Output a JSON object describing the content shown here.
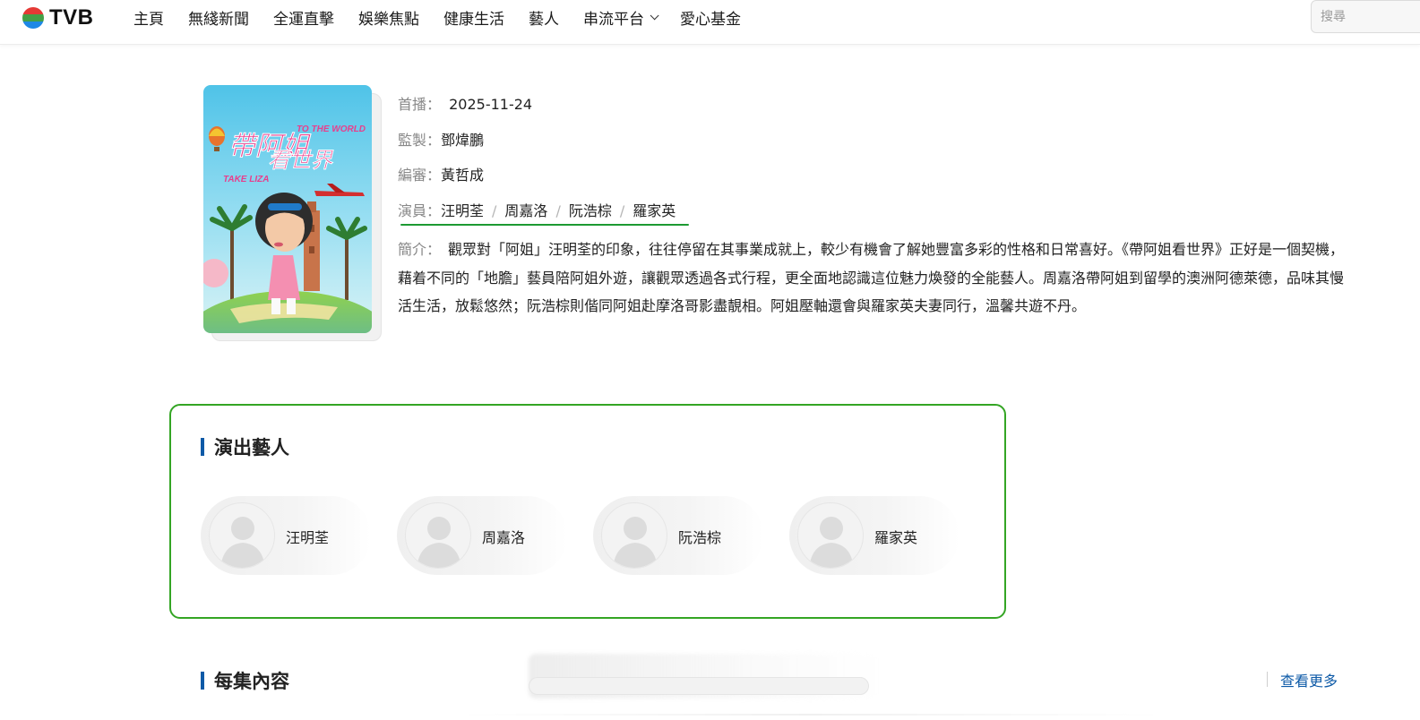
{
  "header": {
    "logo_text": "TVB",
    "nav": [
      {
        "label": "主頁"
      },
      {
        "label": "無綫新聞"
      },
      {
        "label": "全運直擊"
      },
      {
        "label": "娛樂焦點"
      },
      {
        "label": "健康生活"
      },
      {
        "label": "藝人"
      },
      {
        "label": "串流平台",
        "has_dropdown": true
      },
      {
        "label": "愛心基金"
      }
    ],
    "search_placeholder": "搜尋"
  },
  "program": {
    "poster_icon": "program-poster-image",
    "premiere_label": "首播：",
    "premiere_date": "2025-11-24",
    "producer_label": "監製：",
    "producer": "鄧煒鵬",
    "editor_label": "編審：",
    "editor": "黃哲成",
    "cast_label": "演員：",
    "cast": [
      "汪明荃",
      "周嘉洛",
      "阮浩棕",
      "羅家英"
    ],
    "cast_separator": "/",
    "synopsis_label": "簡介：",
    "synopsis": "觀眾對「阿姐」汪明荃的印象，往往停留在其事業成就上，較少有機會了解她豐富多彩的性格和日常喜好。《帶阿姐看世界》正好是一個契機，藉着不同的「地膽」藝員陪阿姐外遊，讓觀眾透過各式行程，更全面地認識這位魅力煥發的全能藝人。周嘉洛帶阿姐到留學的澳洲阿德萊德，品味其慢活生活，放鬆悠然；阮浩棕則偕同阿姐赴摩洛哥影盡靚相。阿姐壓軸還會與羅家英夫妻同行，溫馨共遊不丹。"
  },
  "cast_section": {
    "title": "演出藝人",
    "artists": [
      {
        "name": "汪明荃",
        "icon": "person-placeholder-icon"
      },
      {
        "name": "周嘉洛",
        "icon": "person-placeholder-icon"
      },
      {
        "name": "阮浩棕",
        "icon": "person-placeholder-icon"
      },
      {
        "name": "羅家英",
        "icon": "person-placeholder-icon"
      }
    ]
  },
  "episodes_section": {
    "title": "每集內容",
    "more_label": "查看更多"
  },
  "colors": {
    "accent_green": "#34a524",
    "underline_green": "#1c9a32",
    "brand_blue": "#0d5aa7"
  }
}
